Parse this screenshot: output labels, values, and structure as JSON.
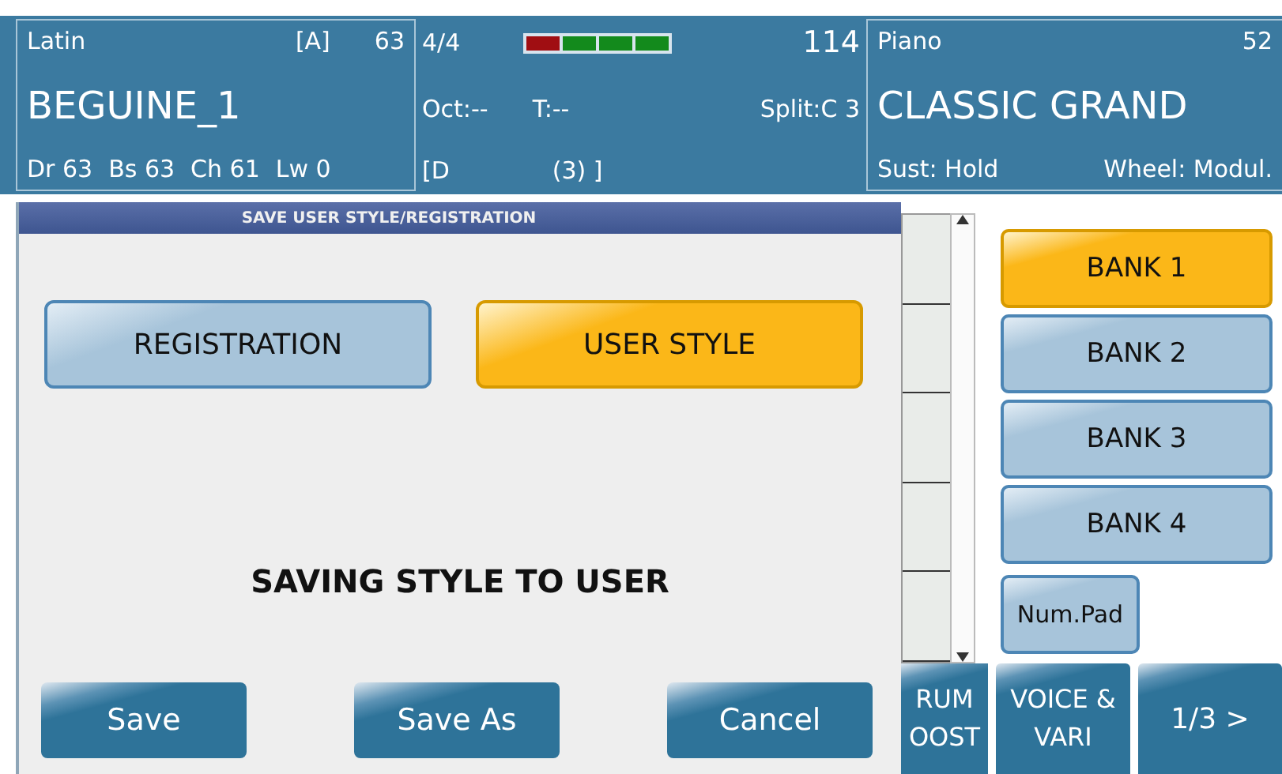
{
  "style_panel": {
    "category": "Latin",
    "variation": "[A]",
    "volume": "63",
    "name": "BEGUINE_1",
    "parts": [
      "Dr 63",
      "Bs 63",
      "Ch 61",
      "Lw 0"
    ]
  },
  "status_panel": {
    "time_signature": "4/4",
    "tempo": "114",
    "beat_lamps": [
      {
        "color": "#a00e12"
      },
      {
        "color": "#138a1c"
      },
      {
        "color": "#138a1c"
      },
      {
        "color": "#138a1c"
      }
    ],
    "octave": "Oct:--",
    "transpose": "T:--",
    "split": "Split:C 3",
    "chord": "[D",
    "chord_count": "(3) ]"
  },
  "voice_panel": {
    "category": "Piano",
    "number": "52",
    "name": "CLASSIC GRAND",
    "sustain": "Sust: Hold",
    "wheel": "Wheel: Modul."
  },
  "dialog": {
    "title": "SAVE USER STYLE/REGISTRATION",
    "modes": [
      {
        "label": "REGISTRATION",
        "selected": false
      },
      {
        "label": "USER STYLE",
        "selected": true
      }
    ],
    "message": "SAVING STYLE TO USER",
    "buttons": [
      "Save",
      "Save As",
      "Cancel"
    ]
  },
  "banks": [
    {
      "label": "BANK 1",
      "selected": true
    },
    {
      "label": "BANK 2",
      "selected": false
    },
    {
      "label": "BANK 3",
      "selected": false
    },
    {
      "label": "BANK 4",
      "selected": false
    }
  ],
  "num_pad": "Num.Pad",
  "nav": [
    {
      "lines": [
        "RUM",
        "OOST"
      ]
    },
    {
      "lines": [
        "VOICE &",
        "VARI"
      ]
    },
    {
      "lines": [
        "1/3 >"
      ]
    }
  ]
}
